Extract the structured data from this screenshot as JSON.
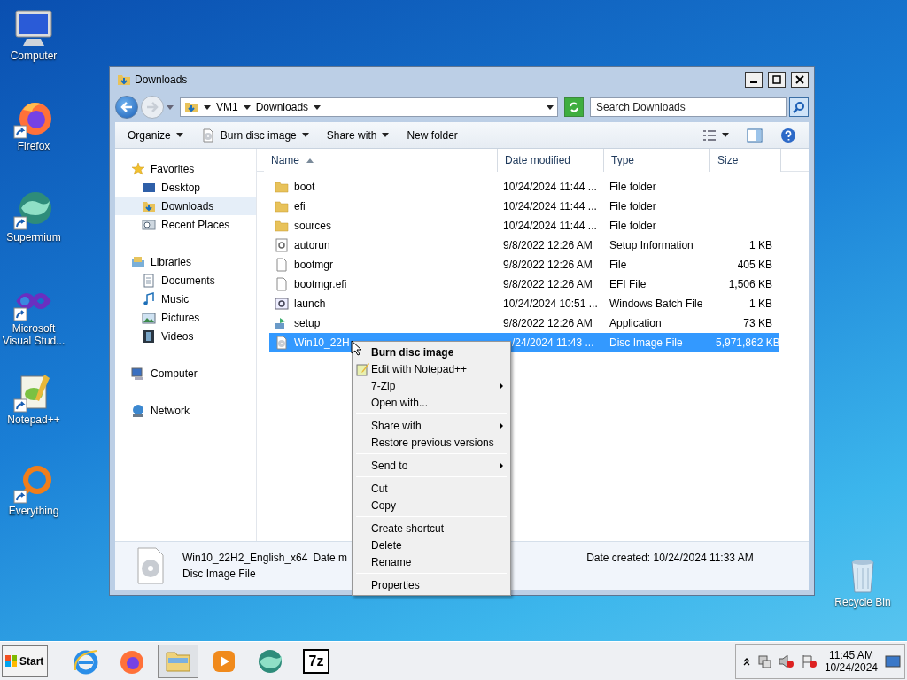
{
  "desktop_icons": [
    {
      "label": "Computer",
      "kind": "computer"
    },
    {
      "label": "Firefox",
      "kind": "firefox"
    },
    {
      "label": "Supermium",
      "kind": "supermium"
    },
    {
      "label": "Microsoft Visual Stud...",
      "kind": "vs"
    },
    {
      "label": "Notepad++",
      "kind": "notepad"
    },
    {
      "label": "Everything",
      "kind": "everything"
    },
    {
      "label": "Recycle Bin",
      "kind": "recycle"
    }
  ],
  "window": {
    "title": "Downloads",
    "breadcrumb": [
      "VM1",
      "Downloads"
    ],
    "search": {
      "placeholder": "Search Downloads"
    },
    "toolbar": [
      {
        "label": "Organize",
        "kind": "plain",
        "dropdown": true
      },
      {
        "label": "Burn disc image",
        "kind": "disc",
        "dropdown": true
      },
      {
        "label": "Share with",
        "kind": "plain",
        "dropdown": true
      },
      {
        "label": "New folder",
        "kind": "plain",
        "dropdown": false
      }
    ],
    "nav": [
      {
        "label": "Favorites",
        "kind": "star",
        "selected": false,
        "children": [
          {
            "label": "Desktop",
            "kind": "desktop",
            "selected": false
          },
          {
            "label": "Downloads",
            "kind": "downloads",
            "selected": true
          },
          {
            "label": "Recent Places",
            "kind": "recent",
            "selected": false
          }
        ]
      },
      {
        "label": "Libraries",
        "kind": "library",
        "selected": false,
        "children": [
          {
            "label": "Documents",
            "kind": "documents",
            "selected": false
          },
          {
            "label": "Music",
            "kind": "music",
            "selected": false
          },
          {
            "label": "Pictures",
            "kind": "pictures",
            "selected": false
          },
          {
            "label": "Videos",
            "kind": "videos",
            "selected": false
          }
        ]
      },
      {
        "label": "Computer",
        "kind": "computer",
        "selected": false
      },
      {
        "label": "Network",
        "kind": "network",
        "selected": false
      }
    ],
    "columns": [
      {
        "label": "Name",
        "sorted": true
      },
      {
        "label": "Date modified",
        "sorted": false
      },
      {
        "label": "Type",
        "sorted": false
      },
      {
        "label": "Size",
        "sorted": false
      }
    ],
    "files": [
      {
        "name": "boot",
        "date": "10/24/2024 11:44 ...",
        "type": "File folder",
        "kind": "folder",
        "selected": false
      },
      {
        "name": "efi",
        "date": "10/24/2024 11:44 ...",
        "type": "File folder",
        "kind": "folder",
        "selected": false
      },
      {
        "name": "sources",
        "date": "10/24/2024 11:44 ...",
        "type": "File folder",
        "kind": "folder",
        "selected": false
      },
      {
        "name": "autorun",
        "date": "9/8/2022 12:26 AM",
        "type": "Setup Information",
        "size": "1 KB",
        "kind": "settings",
        "selected": false
      },
      {
        "name": "bootmgr",
        "date": "9/8/2022 12:26 AM",
        "type": "File",
        "size": "405 KB",
        "kind": "blank",
        "selected": false
      },
      {
        "name": "bootmgr.efi",
        "date": "9/8/2022 12:26 AM",
        "type": "EFI File",
        "size": "1,506 KB",
        "kind": "blank",
        "selected": false
      },
      {
        "name": "launch",
        "date": "10/24/2024 10:51 ...",
        "type": "Windows Batch File",
        "size": "1 KB",
        "kind": "batch",
        "selected": false
      },
      {
        "name": "setup",
        "date": "9/8/2022 12:26 AM",
        "type": "Application",
        "size": "73 KB",
        "kind": "app",
        "selected": false
      },
      {
        "name": "Win10_22H",
        "date": "/24/2024 11:43 ...",
        "type": "Disc Image File",
        "size": "5,971,862 KB",
        "kind": "disc",
        "selected": true
      }
    ],
    "details": {
      "name": "Win10_22H2_English_x64",
      "type": "Disc Image File",
      "modified_label": "Date m",
      "created": "Date created: 10/24/2024 11:33 AM"
    }
  },
  "context_menu": {
    "groups": [
      [
        {
          "label": "Burn disc image",
          "bold": true,
          "submenu": false,
          "icon": false
        },
        {
          "label": "Edit with Notepad++",
          "bold": false,
          "submenu": false,
          "icon": true
        },
        {
          "label": "7-Zip",
          "bold": false,
          "submenu": true,
          "icon": false
        },
        {
          "label": "Open with...",
          "bold": false,
          "submenu": false,
          "icon": false
        }
      ],
      [
        {
          "label": "Share with",
          "bold": false,
          "submenu": true,
          "icon": false
        },
        {
          "label": "Restore previous versions",
          "bold": false,
          "submenu": false,
          "icon": false
        }
      ],
      [
        {
          "label": "Send to",
          "bold": false,
          "submenu": true,
          "icon": false
        }
      ],
      [
        {
          "label": "Cut",
          "bold": false,
          "submenu": false,
          "icon": false
        },
        {
          "label": "Copy",
          "bold": false,
          "submenu": false,
          "icon": false
        }
      ],
      [
        {
          "label": "Create shortcut",
          "bold": false,
          "submenu": false,
          "icon": false
        },
        {
          "label": "Delete",
          "bold": false,
          "submenu": false,
          "icon": false
        },
        {
          "label": "Rename",
          "bold": false,
          "submenu": false,
          "icon": false
        }
      ],
      [
        {
          "label": "Properties",
          "bold": false,
          "submenu": false,
          "icon": false
        }
      ]
    ]
  },
  "taskbar": {
    "start": "Start",
    "apps": [
      {
        "kind": "ie",
        "selected": false
      },
      {
        "kind": "firefox",
        "selected": false
      },
      {
        "kind": "explorer",
        "selected": true
      },
      {
        "kind": "media",
        "selected": false
      },
      {
        "kind": "supermium",
        "selected": false
      },
      {
        "kind": "sevenzip",
        "label": "7z",
        "selected": false
      }
    ],
    "clock": {
      "time": "11:45 AM",
      "date": "10/24/2024"
    }
  }
}
